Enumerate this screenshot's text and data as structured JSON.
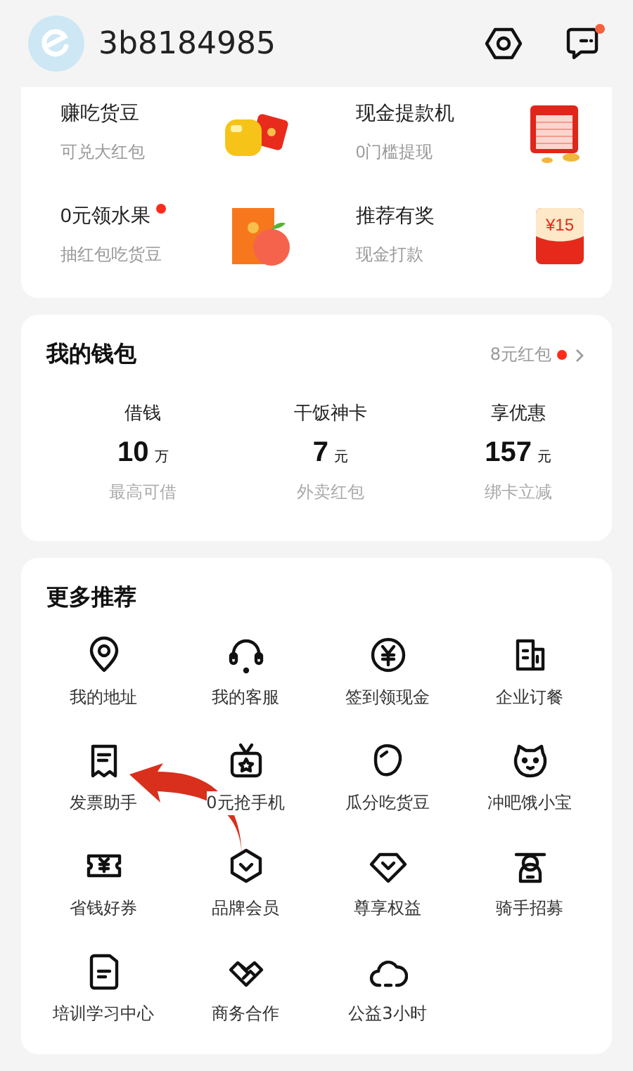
{
  "header": {
    "username": "3b8184985",
    "messages_unread": true
  },
  "promos": [
    {
      "title": "赚吃货豆",
      "subtitle": "可兑大红包",
      "kind": "beans",
      "dot": false
    },
    {
      "title": "现金提款机",
      "subtitle": "0门槛提现",
      "kind": "atm",
      "dot": false
    },
    {
      "title": "0元领水果",
      "subtitle": "抽红包吃货豆",
      "kind": "fruit",
      "dot": true
    },
    {
      "title": "推荐有奖",
      "subtitle": "现金打款",
      "kind": "envelope",
      "badge": "¥15",
      "dot": false
    }
  ],
  "wallet": {
    "title": "我的钱包",
    "link": "8元红包",
    "link_dot": true,
    "items": [
      {
        "label": "借钱",
        "value": "10",
        "unit": "万",
        "note": "最高可借"
      },
      {
        "label": "干饭神卡",
        "value": "7",
        "unit": "元",
        "note": "外卖红包"
      },
      {
        "label": "享优惠",
        "value": "157",
        "unit": "元",
        "note": "绑卡立减"
      }
    ]
  },
  "more": {
    "title": "更多推荐",
    "items": [
      {
        "label": "我的地址",
        "kind": "pin"
      },
      {
        "label": "我的客服",
        "kind": "headset"
      },
      {
        "label": "签到领现金",
        "kind": "yen"
      },
      {
        "label": "企业订餐",
        "kind": "building"
      },
      {
        "label": "发票助手",
        "kind": "receipt"
      },
      {
        "label": "0元抢手机",
        "kind": "gift"
      },
      {
        "label": "瓜分吃货豆",
        "kind": "bean"
      },
      {
        "label": "冲吧饿小宝",
        "kind": "tiger"
      },
      {
        "label": "省钱好券",
        "kind": "ticket"
      },
      {
        "label": "品牌会员",
        "kind": "hexagon"
      },
      {
        "label": "尊享权益",
        "kind": "diamond"
      },
      {
        "label": "骑手招募",
        "kind": "rider"
      },
      {
        "label": "培训学习中心",
        "kind": "book"
      },
      {
        "label": "商务合作",
        "kind": "handshake"
      },
      {
        "label": "公益3小时",
        "kind": "cloud"
      }
    ]
  },
  "annotation": {
    "kind": "arrow"
  }
}
